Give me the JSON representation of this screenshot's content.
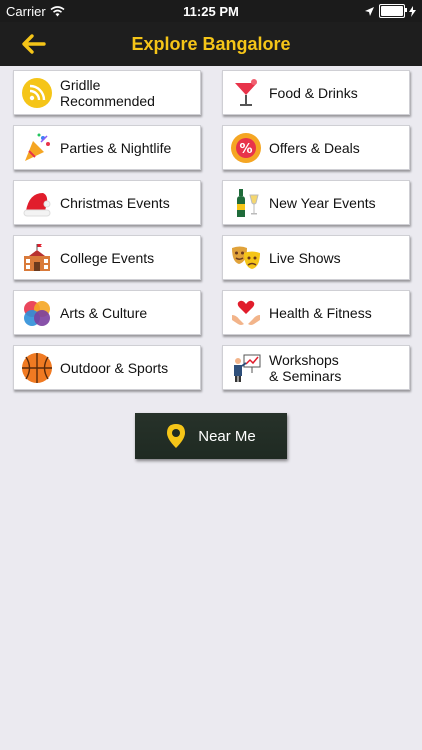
{
  "status": {
    "carrier": "Carrier",
    "time": "11:25 PM"
  },
  "nav": {
    "title": "Explore Bangalore"
  },
  "tiles": [
    {
      "label": "Gridlle\nRecommended",
      "icon": "rss-icon"
    },
    {
      "label": "Food & Drinks",
      "icon": "cocktail-icon"
    },
    {
      "label": "Parties & Nightlife",
      "icon": "party-popper-icon"
    },
    {
      "label": "Offers & Deals",
      "icon": "percent-badge-icon"
    },
    {
      "label": "Christmas Events",
      "icon": "santa-hat-icon"
    },
    {
      "label": "New Year Events",
      "icon": "champagne-icon"
    },
    {
      "label": "College Events",
      "icon": "school-building-icon"
    },
    {
      "label": "Live Shows",
      "icon": "theater-masks-icon"
    },
    {
      "label": "Arts & Culture",
      "icon": "palette-circles-icon"
    },
    {
      "label": "Health & Fitness",
      "icon": "heart-hands-icon"
    },
    {
      "label": "Outdoor & Sports",
      "icon": "basketball-icon"
    },
    {
      "label": "Workshops\n& Seminars",
      "icon": "presentation-icon"
    }
  ],
  "near_me": {
    "label": "Near Me",
    "icon": "location-pin-icon"
  },
  "colors": {
    "accent": "#f5c518",
    "navbar": "#1e1e1e",
    "background": "#ebeaf0"
  }
}
